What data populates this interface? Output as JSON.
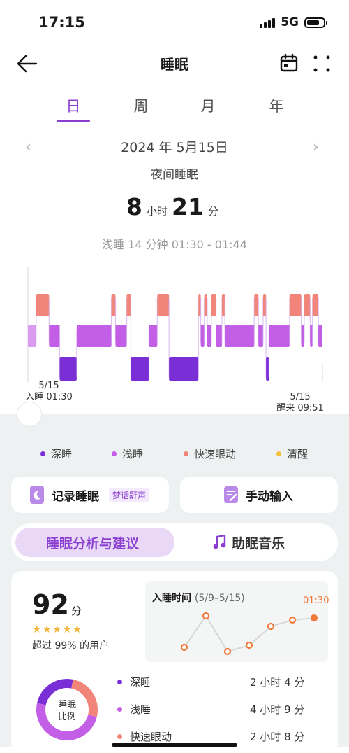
{
  "status": {
    "time": "17:15",
    "network": "5G"
  },
  "header": {
    "title": "睡眠",
    "icons": [
      "back-arrow-icon",
      "calendar-icon",
      "more-dots-icon"
    ]
  },
  "tabs": [
    {
      "label": "日"
    },
    {
      "label": "周"
    },
    {
      "label": "月"
    },
    {
      "label": "年"
    }
  ],
  "date_nav": {
    "date": "2024 年 5月15日",
    "subtitle": "夜间睡眠"
  },
  "duration": {
    "hours": "8",
    "hours_unit": "小时",
    "minutes": "21",
    "minutes_unit": "分"
  },
  "selected_segment": "浅睡 14 分钟 01:30 - 01:44",
  "chart_labels": {
    "start_date": "5/15",
    "start_time": "入睡 01:30",
    "end_date": "5/15",
    "end_time": "醒来 09:51"
  },
  "colors": {
    "deep": "#7a2fd6",
    "light": "#c35ee6",
    "rem": "#f2857a",
    "awake": "#f3c13a",
    "accent": "#8a3fd1",
    "trend_point": "#f07a3c"
  },
  "chart_data": {
    "type": "hypnogram",
    "stage_order": [
      "清醒",
      "快速眼动",
      "浅睡",
      "深睡"
    ],
    "start": "01:30",
    "end": "09:51",
    "segments": [
      {
        "stage": "浅睡",
        "start": "01:30",
        "end": "01:44"
      },
      {
        "stage": "快速眼动",
        "start": "01:44",
        "end": "02:06"
      },
      {
        "stage": "浅睡",
        "start": "02:06",
        "end": "02:24"
      },
      {
        "stage": "深睡",
        "start": "02:24",
        "end": "02:53"
      },
      {
        "stage": "浅睡",
        "start": "02:53",
        "end": "03:52"
      },
      {
        "stage": "快速眼动",
        "start": "03:52",
        "end": "03:59"
      },
      {
        "stage": "浅睡",
        "start": "03:59",
        "end": "04:18"
      },
      {
        "stage": "快速眼动",
        "start": "04:18",
        "end": "04:25"
      },
      {
        "stage": "深睡",
        "start": "04:25",
        "end": "04:56"
      },
      {
        "stage": "浅睡",
        "start": "04:56",
        "end": "05:10"
      },
      {
        "stage": "快速眼动",
        "start": "05:10",
        "end": "05:30"
      },
      {
        "stage": "深睡",
        "start": "05:30",
        "end": "06:20"
      },
      {
        "stage": "快速眼动",
        "start": "06:20",
        "end": "06:24"
      },
      {
        "stage": "浅睡",
        "start": "06:24",
        "end": "06:30"
      },
      {
        "stage": "快速眼动",
        "start": "06:30",
        "end": "06:35"
      },
      {
        "stage": "浅睡",
        "start": "06:35",
        "end": "06:42"
      },
      {
        "stage": "快速眼动",
        "start": "06:42",
        "end": "06:50"
      },
      {
        "stage": "浅睡",
        "start": "06:50",
        "end": "07:00"
      },
      {
        "stage": "快速眼动",
        "start": "07:00",
        "end": "07:05"
      },
      {
        "stage": "浅睡",
        "start": "07:05",
        "end": "07:55"
      },
      {
        "stage": "快速眼动",
        "start": "07:55",
        "end": "08:02"
      },
      {
        "stage": "浅睡",
        "start": "08:02",
        "end": "08:10"
      },
      {
        "stage": "快速眼动",
        "start": "08:10",
        "end": "08:15"
      },
      {
        "stage": "深睡",
        "start": "08:15",
        "end": "08:20"
      },
      {
        "stage": "浅睡",
        "start": "08:20",
        "end": "08:55"
      },
      {
        "stage": "快速眼动",
        "start": "08:55",
        "end": "09:15"
      },
      {
        "stage": "浅睡",
        "start": "09:15",
        "end": "09:20"
      },
      {
        "stage": "快速眼动",
        "start": "09:20",
        "end": "09:30"
      },
      {
        "stage": "浅睡",
        "start": "09:30",
        "end": "09:34"
      },
      {
        "stage": "快速眼动",
        "start": "09:34",
        "end": "09:44"
      },
      {
        "stage": "浅睡",
        "start": "09:44",
        "end": "09:51"
      }
    ]
  },
  "legend": [
    {
      "label": "深睡",
      "color": "#7a2fd6"
    },
    {
      "label": "浅睡",
      "color": "#c35ee6"
    },
    {
      "label": "快速眼动",
      "color": "#f2857a"
    },
    {
      "label": "清醒",
      "color": "#f3c13a"
    }
  ],
  "actions": {
    "record_label": "记录睡眠",
    "record_badge": "梦话鼾声",
    "manual_label": "手动输入"
  },
  "segmented": {
    "analysis": "睡眠分析与建议",
    "music": "助眠音乐"
  },
  "score": {
    "value": "92",
    "unit": "分",
    "stars": "★★★★★",
    "stars_count": 5,
    "beat": "超过 99% 的用户"
  },
  "trend": {
    "title": "入睡时间",
    "range": "(5/9–5/15)",
    "last_label": "01:30",
    "x": [
      "5/9",
      "5/10",
      "5/11",
      "5/12",
      "5/13",
      "5/14",
      "5/15"
    ],
    "y_relative": [
      0.15,
      0.9,
      0.05,
      0.2,
      0.65,
      0.8,
      0.85
    ]
  },
  "ratio": {
    "label_line1": "睡眠",
    "label_line2": "比例",
    "stages": [
      {
        "name": "深睡",
        "value": "2 小时 4 分",
        "minutes": 124,
        "color": "#7a2fd6"
      },
      {
        "name": "浅睡",
        "value": "4 小时 9 分",
        "minutes": 249,
        "color": "#c35ee6"
      },
      {
        "name": "快速眼动",
        "value": "2 小时 8 分",
        "minutes": 128,
        "color": "#f2857a"
      }
    ]
  }
}
